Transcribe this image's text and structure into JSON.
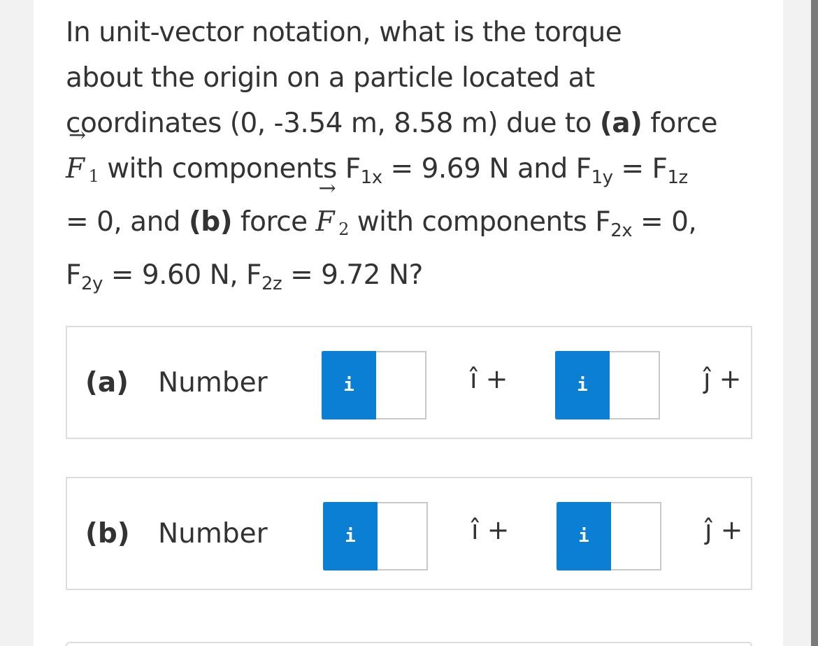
{
  "question": {
    "line1": "In unit-vector notation, what is the torque",
    "line2": "about the origin on a particle located at",
    "line3a": "coordinates (0, -3.54 m, 8.58 m) due to ",
    "a_marker": "(a)",
    "line3b": " force",
    "f_symbol": "F",
    "arrow": "→",
    "f1_index": "1",
    "line4a": " with components F",
    "sub_1x": "1x",
    "line4b": " = 9.69 N and F",
    "sub_1y": "1y",
    "line4c": " = F",
    "sub_1z": "1z",
    "line5a": "= 0, and ",
    "b_marker": "(b)",
    "line5b": " force ",
    "f2_index": "2",
    "line5c": " with components F",
    "sub_2x": "2x",
    "line5d": " = 0,",
    "line6a": "F",
    "sub_2y": "2y",
    "line6b": " = 9.60 N, F",
    "sub_2z": "2z",
    "line6c": " = 9.72 N?"
  },
  "parts": [
    {
      "label": "(a)",
      "number_label": "Number",
      "fields": [
        {
          "info_icon": "i",
          "value": "",
          "unit": "î +"
        },
        {
          "info_icon": "i",
          "value": "",
          "unit": "ĵ +"
        }
      ]
    },
    {
      "label": "(b)",
      "number_label": "Number",
      "fields": [
        {
          "info_icon": "i",
          "value": "",
          "unit": "î +"
        },
        {
          "info_icon": "i",
          "value": "",
          "unit": "ĵ +"
        }
      ]
    }
  ],
  "colors": {
    "info_button": "#0b7fd4",
    "text": "#333333",
    "border": "#dcdcdc"
  }
}
